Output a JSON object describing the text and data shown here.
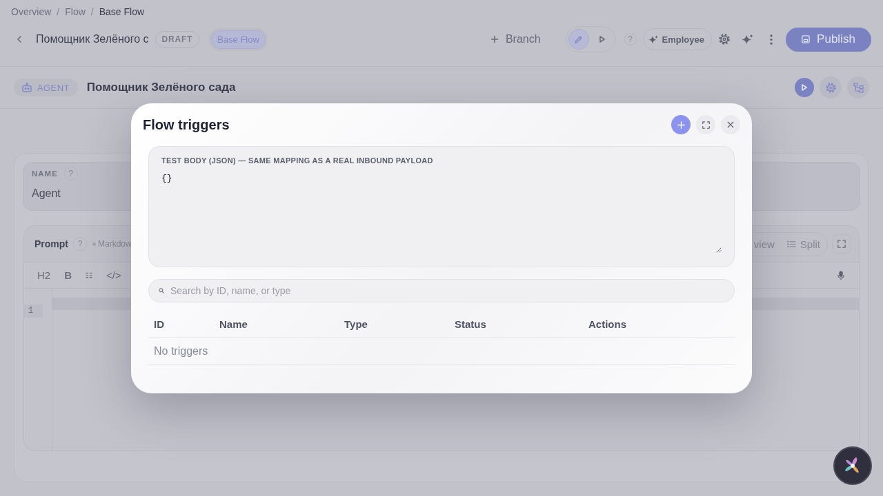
{
  "breadcrumb": [
    {
      "label": "Overview",
      "current": false
    },
    {
      "separator": "/",
      "label": "Flow",
      "current": false
    },
    {
      "separator": "/",
      "label": "Base Flow",
      "current": true
    }
  ],
  "header": {
    "title": "Помощник Зелёного с",
    "status": "DRAFT",
    "flow_chip": "Base Flow",
    "branch_button": "Branch",
    "modes": [
      {
        "kind": "edit",
        "selected": true
      },
      {
        "kind": "run",
        "selected": false
      }
    ],
    "help": "?",
    "employee_button": "Employee",
    "publish_button": "Publish"
  },
  "node_bar": {
    "type_badge": "AGENT",
    "title": "Помощник Зелёного сада"
  },
  "name_field": {
    "label": "NAME",
    "help": "?",
    "value": "Agent"
  },
  "prompt_editor": {
    "label": "Prompt",
    "help": "?",
    "format": "Markdow",
    "views": [
      {
        "kind": "preview",
        "label": "view",
        "selected": false
      },
      {
        "kind": "split",
        "label": "Split",
        "selected": false
      }
    ],
    "toolbar": [
      {
        "kind": "heading",
        "label": "H2"
      },
      {
        "kind": "bold",
        "label": "B"
      },
      {
        "kind": "list"
      },
      {
        "kind": "code",
        "label": "</>"
      }
    ],
    "line_numbers": [
      "1"
    ]
  },
  "dialog": {
    "title": "Flow triggers",
    "body_field": {
      "label": "TEST BODY (JSON) — SAME MAPPING AS A REAL INBOUND PAYLOAD",
      "value": "{}"
    },
    "search": {
      "placeholder": "Search by ID, name, or type"
    },
    "table": {
      "columns": [
        "ID",
        "Name",
        "Type",
        "Status",
        "Actions"
      ],
      "empty_text": "No triggers"
    }
  }
}
